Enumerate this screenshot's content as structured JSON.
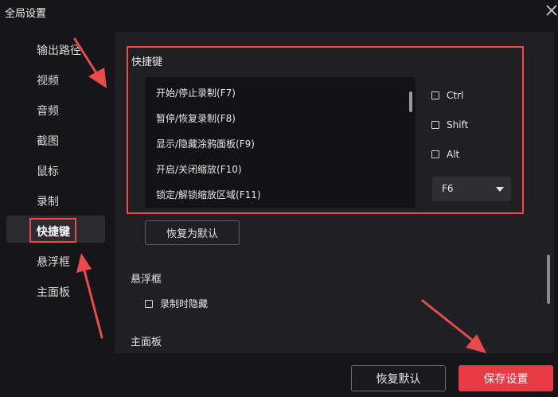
{
  "window": {
    "title": "全局设置"
  },
  "sidebar": {
    "items": [
      {
        "label": "输出路径"
      },
      {
        "label": "视频"
      },
      {
        "label": "音频"
      },
      {
        "label": "截图"
      },
      {
        "label": "鼠标"
      },
      {
        "label": "录制"
      },
      {
        "label": "快捷键",
        "active": true
      },
      {
        "label": "悬浮框"
      },
      {
        "label": "主面板"
      }
    ]
  },
  "hotkeys": {
    "section_label": "快捷键",
    "actions": [
      "开始/停止录制(F7)",
      "暂停/恢复录制(F8)",
      "显示/隐藏涂鸦面板(F9)",
      "开启/关闭缩放(F10)",
      "锁定/解锁缩放区域(F11)"
    ],
    "modifiers": [
      {
        "label": "Ctrl",
        "checked": false
      },
      {
        "label": "Shift",
        "checked": false
      },
      {
        "label": "Alt",
        "checked": false
      }
    ],
    "key_value": "F6",
    "restore_default_label": "恢复为默认"
  },
  "floating": {
    "section_label": "悬浮框",
    "hide_when_recording_label": "录制时隐藏",
    "hide_when_recording_checked": false
  },
  "main_panel": {
    "section_label": "主面板"
  },
  "footer": {
    "restore_label": "恢复默认",
    "save_label": "保存设置"
  },
  "colors": {
    "accent": "#e83a45",
    "highlight_border": "#e84b4b",
    "background": "#161618",
    "panel": "#202024"
  },
  "icons": {
    "close": "close-icon",
    "dropdown": "caret-down-icon"
  }
}
